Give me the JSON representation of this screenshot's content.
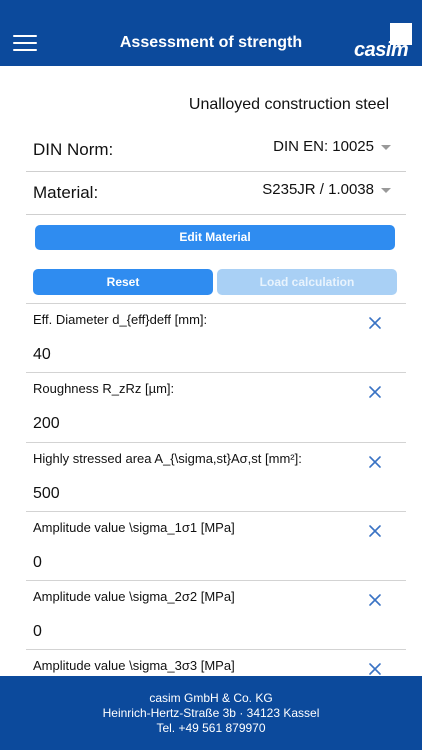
{
  "header": {
    "title": "Assessment of strength",
    "logo_text": "casim"
  },
  "steel_type": "Unalloyed construction steel",
  "din_norm": {
    "label": "DIN Norm:",
    "value": "DIN EN: 10025"
  },
  "material": {
    "label": "Material:",
    "value": "S235JR / 1.0038"
  },
  "buttons": {
    "edit_material": "Edit Material",
    "reset": "Reset",
    "load_calculation": "Load calculation"
  },
  "fields": [
    {
      "label": "Eff. Diameter d_{eff}deff [mm]:",
      "value": "40"
    },
    {
      "label": "Roughness R_zRz [µm]:",
      "value": "200"
    },
    {
      "label": "Highly stressed area A_{\\sigma,st}Aσ,st [mm²]:",
      "value": "500"
    },
    {
      "label": "Amplitude value \\sigma_1σ1 [MPa]",
      "value": "0"
    },
    {
      "label": "Amplitude value \\sigma_2σ2 [MPa]",
      "value": "0"
    },
    {
      "label": "Amplitude value \\sigma_3σ3 [MPa]",
      "value": ""
    }
  ],
  "footer": {
    "company": "casim GmbH & Co. KG",
    "address": "Heinrich-Hertz-Straße 3b · 34123 Kassel",
    "phone": "Tel. +49 561 879970"
  }
}
